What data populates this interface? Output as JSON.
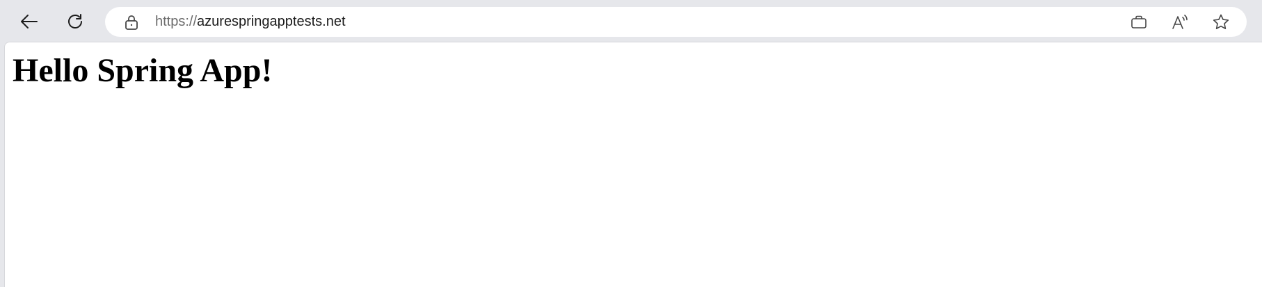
{
  "browser": {
    "back_icon": "arrow-left-icon",
    "reload_icon": "refresh-icon",
    "address_bar": {
      "lock_icon": "lock-icon",
      "url_scheme": "https://",
      "url_host": "azurespringapptests.net"
    },
    "toolbar_icons": [
      "app-available-icon",
      "read-aloud-icon",
      "favorite-star-icon"
    ]
  },
  "page": {
    "heading": "Hello Spring App!"
  }
}
